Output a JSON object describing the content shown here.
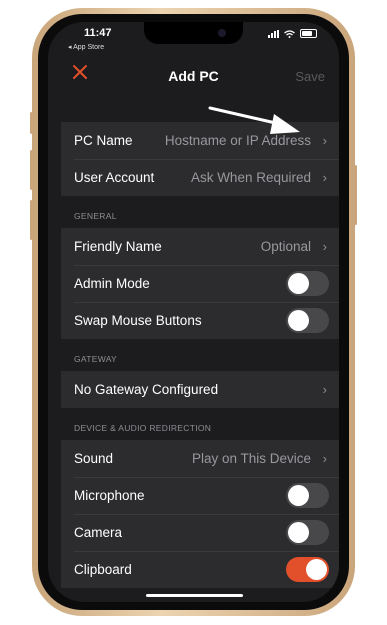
{
  "status_bar": {
    "time": "11:47",
    "back_label": "◂ App Store"
  },
  "nav": {
    "close_icon": "close-icon",
    "title": "Add PC",
    "save_label": "Save"
  },
  "groups": {
    "pc": {
      "rows": [
        {
          "label": "PC Name",
          "value": "Hostname or IP Address"
        },
        {
          "label": "User Account",
          "value": "Ask When Required"
        }
      ]
    },
    "general": {
      "header": "GENERAL",
      "rows": [
        {
          "label": "Friendly Name",
          "value": "Optional"
        },
        {
          "label": "Admin Mode",
          "toggle": false
        },
        {
          "label": "Swap Mouse Buttons",
          "toggle": false
        }
      ]
    },
    "gateway": {
      "header": "GATEWAY",
      "rows": [
        {
          "label": "No Gateway Configured"
        }
      ]
    },
    "device": {
      "header": "DEVICE & AUDIO REDIRECTION",
      "rows": [
        {
          "label": "Sound",
          "value": "Play on This Device"
        },
        {
          "label": "Microphone",
          "toggle": false
        },
        {
          "label": "Camera",
          "toggle": false
        },
        {
          "label": "Clipboard",
          "toggle": true
        }
      ]
    }
  },
  "colors": {
    "accent": "#e2502b",
    "background": "#1c1c1e",
    "cell": "#2c2c2e",
    "secondary_text": "#98989d"
  }
}
